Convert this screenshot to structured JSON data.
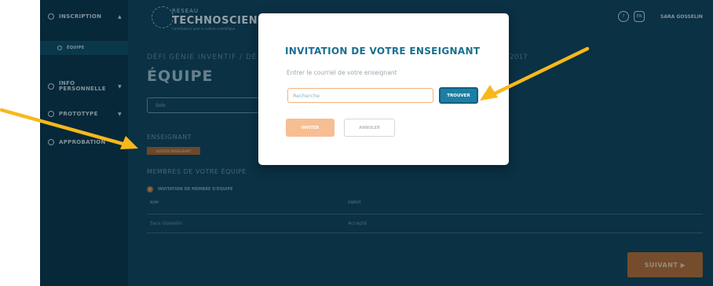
{
  "sidebar": {
    "items": [
      {
        "label": "INSCRIPTION",
        "caret": "▲"
      },
      {
        "label": "ÉQUIPE",
        "caret": ""
      },
      {
        "label": "INFO PERSONNELLE",
        "caret": "▼"
      },
      {
        "label": "PROTOTYPE",
        "caret": "▼"
      },
      {
        "label": "APPROBATION",
        "caret": ""
      }
    ]
  },
  "logo": {
    "small": "RÉSEAU",
    "big": "TECHNOSCIENCE",
    "tagline": "Contributeur pour la culture scientifique"
  },
  "header": {
    "help": "?",
    "lang": "EN",
    "user": "SARA GOSSELIN"
  },
  "main": {
    "breadcrumb": "DÉFI GÉNIE INVENTIF / DÉ",
    "breadcrumb_tail": "2017",
    "title": "ÉQUIPE",
    "team_type": "Solo",
    "teacher_section": "ENSEIGNANT",
    "add_teacher": "AJOUTER ENSEIGNANT",
    "members_section": "MEMBRES DE VOTRE ÉQUIPE",
    "invite_member": "INVITATION DE MEMBRE D'ÉQUIPE",
    "table": {
      "headers": [
        "NOM",
        "STATUT"
      ],
      "rows": [
        [
          "Sara Gosselin",
          "Accepté"
        ]
      ]
    },
    "next": "SUIVANT ▶"
  },
  "modal": {
    "title": "INVITATION DE VOTRE ENSEIGNANT",
    "subtitle": "Entrer le courriel de votre enseignant",
    "search_placeholder": "Recherche",
    "find_label": "TROUVER",
    "invite_label": "INVITER",
    "cancel_label": "ANNULER"
  },
  "colors": {
    "accent": "#1d7ea4",
    "orange": "#f7be92",
    "arrow": "#f6b91c",
    "sidebar": "#083246"
  }
}
